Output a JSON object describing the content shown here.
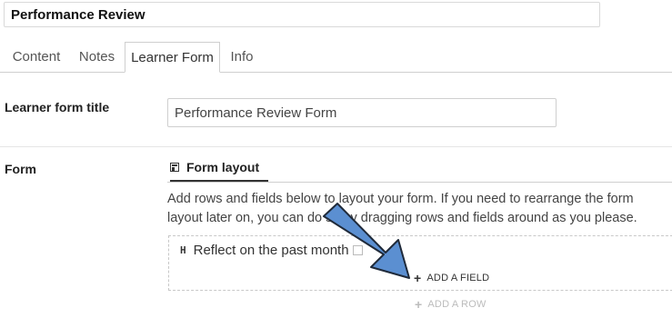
{
  "header": {
    "title_value": "Performance Review"
  },
  "tabs": [
    {
      "label": "Content"
    },
    {
      "label": "Notes"
    },
    {
      "label": "Learner Form"
    },
    {
      "label": "Info"
    }
  ],
  "learner_form_title": {
    "label": "Learner form title",
    "value": "Performance Review Form"
  },
  "form": {
    "label": "Form",
    "section_tab": "Form layout",
    "help_text": "Add rows and fields below to layout your form. If you need to rearrange the form layout later on, you can do so by dragging rows and fields around as you please.",
    "heading_marker": "H",
    "heading_text": "Reflect on the past month",
    "add_field_label": "ADD A FIELD",
    "add_row_label": "ADD A ROW"
  },
  "annotation": {
    "icon": "arrow-icon",
    "color": "#5b8fd1"
  }
}
